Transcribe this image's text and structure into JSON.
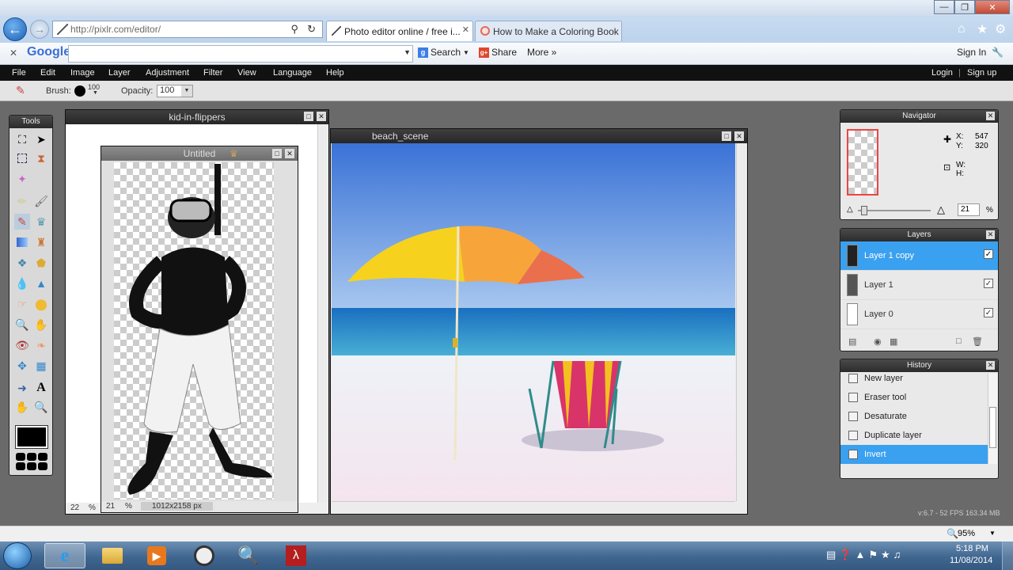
{
  "browser": {
    "address": "http://pixlr.com/editor/",
    "tabs": [
      {
        "label": "Photo editor online / free i...",
        "active": true
      },
      {
        "label": "How to Make a Coloring Book",
        "active": false
      }
    ]
  },
  "google_toolbar": {
    "brand": "Google",
    "search_label": "Search",
    "share_label": "Share",
    "more_label": "More »",
    "signin_label": "Sign In"
  },
  "menu": {
    "items": [
      "File",
      "Edit",
      "Image",
      "Layer",
      "Adjustment",
      "Filter",
      "View",
      "Language",
      "Help"
    ],
    "login": "Login",
    "signup": "Sign up",
    "separator": "|"
  },
  "options": {
    "brush_label": "Brush:",
    "brush_size": "100",
    "opacity_label": "Opacity:",
    "opacity_value": "100"
  },
  "tools_panel": {
    "title": "Tools"
  },
  "doc_kid": {
    "title": "kid-in-flippers",
    "zoom": "22",
    "percent": "%"
  },
  "doc_untitled": {
    "title": "Untitled",
    "zoom": "21",
    "percent": "%",
    "size": "1012x2158 px"
  },
  "doc_beach": {
    "title": "beach_scene"
  },
  "navigator": {
    "title": "Navigator",
    "x_label": "X:",
    "x_value": "547",
    "y_label": "Y:",
    "y_value": "320",
    "w_label": "W:",
    "h_label": "H:",
    "zoom": "21",
    "percent": "%"
  },
  "layers": {
    "title": "Layers",
    "items": [
      {
        "name": "Layer 1 copy",
        "selected": true
      },
      {
        "name": "Layer 1",
        "selected": false
      },
      {
        "name": "Layer 0",
        "selected": false
      }
    ]
  },
  "history": {
    "title": "History",
    "items": [
      {
        "name": "New layer",
        "selected": false
      },
      {
        "name": "Eraser tool",
        "selected": false
      },
      {
        "name": "Desaturate",
        "selected": false
      },
      {
        "name": "Duplicate layer",
        "selected": false
      },
      {
        "name": "Invert",
        "selected": true
      }
    ]
  },
  "version": "v:6.7 - 52 FPS 163.34 MB",
  "status": {
    "zoom": "95%"
  },
  "taskbar": {
    "time": "5:18 PM",
    "date": "11/08/2014"
  },
  "colors": {
    "accent_blue": "#3aa0f0",
    "menu_bg": "#111111",
    "workspace": "#6a6a6a"
  }
}
